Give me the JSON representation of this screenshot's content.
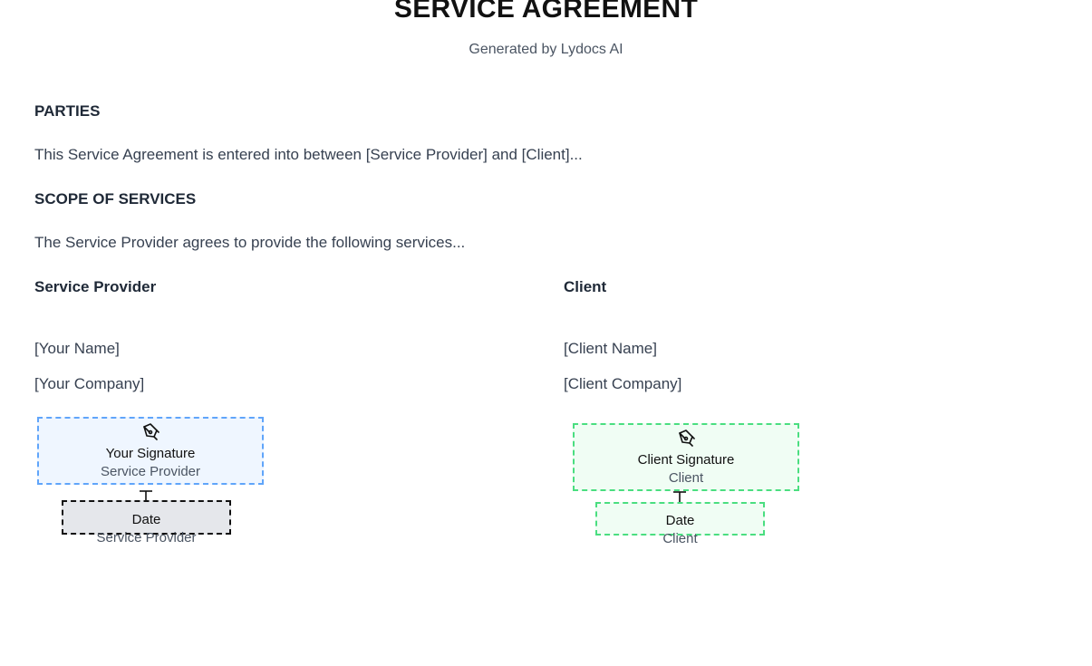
{
  "document": {
    "title": "SERVICE AGREEMENT",
    "subtitle": "Generated by Lydocs AI",
    "sections": [
      {
        "heading": "PARTIES",
        "text": "This Service Agreement is entered into between [Service Provider] and [Client]..."
      },
      {
        "heading": "SCOPE OF SERVICES",
        "text": "The Service Provider agrees to provide the following services..."
      }
    ]
  },
  "provider": {
    "heading": "Service Provider",
    "name": "[Your Name]",
    "company": "[Your Company]",
    "signature_label": "Your Signature",
    "signature_role": "Service Provider",
    "date_label": "Date",
    "date_role": "Service Provider"
  },
  "client": {
    "heading": "Client",
    "name": "[Client Name]",
    "company": "[Client Company]",
    "signature_label": "Client Signature",
    "signature_role": "Client",
    "date_label": "Date",
    "date_role": "Client"
  },
  "colors": {
    "provider_accent": "#60a5fa",
    "client_accent": "#4ade80",
    "selected_field": "#111111"
  },
  "icons": [
    "pen-nib-icon",
    "text-cursor-icon"
  ]
}
